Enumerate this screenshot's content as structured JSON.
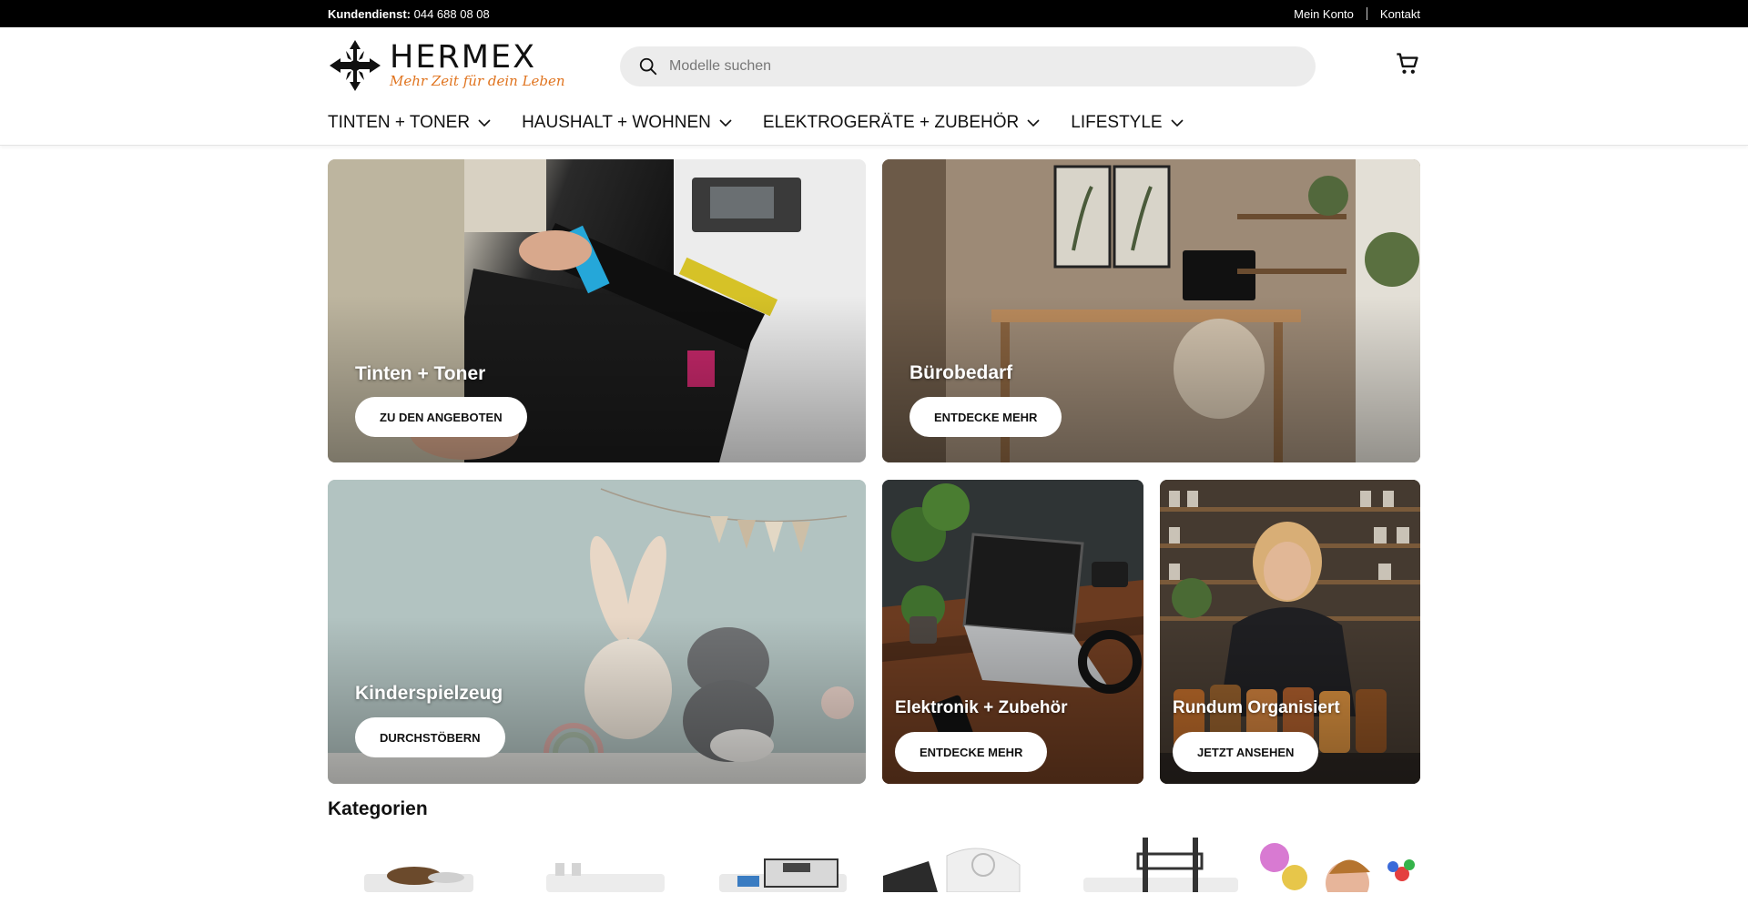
{
  "topbar": {
    "service_label": "Kundendienst:",
    "service_phone": "044 688 08 08",
    "account": "Mein Konto",
    "contact": "Kontakt"
  },
  "header": {
    "logo_name": "HERMEX",
    "logo_slogan": "Mehr Zeit für dein Leben",
    "search_placeholder": "Modelle suchen"
  },
  "nav": [
    {
      "label": "TINTEN + TONER"
    },
    {
      "label": "HAUSHALT + WOHNEN"
    },
    {
      "label": "ELEKTROGERÄTE + ZUBEHÖR"
    },
    {
      "label": "LIFESTYLE"
    }
  ],
  "tiles": [
    {
      "title": "Tinten + Toner",
      "button": "ZU DEN ANGEBOTEN"
    },
    {
      "title": "Bürobedarf",
      "button": "ENTDECKE MEHR"
    },
    {
      "title": "Kinderspielzeug",
      "button": "DURCHSTÖBERN"
    },
    {
      "title": "Elektronik + Zubehör",
      "button": "ENTDECKE MEHR"
    },
    {
      "title": "Rundum Organisiert",
      "button": "JETZT ANSEHEN"
    }
  ],
  "categories": {
    "heading": "Kategorien"
  },
  "colors": {
    "accent": "#e0741f",
    "topbar": "#000000"
  }
}
